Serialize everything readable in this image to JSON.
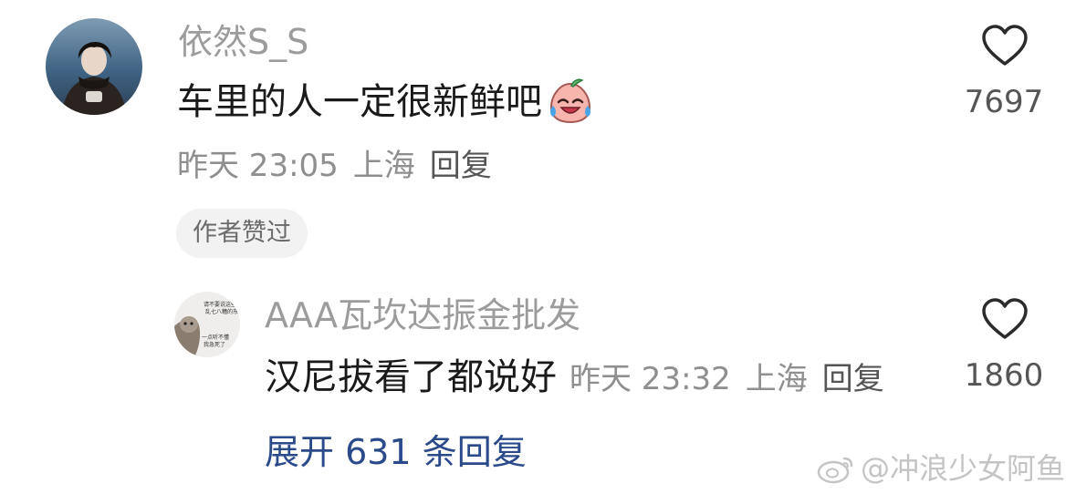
{
  "comment": {
    "username": "依然S_S",
    "text": "车里的人一定很新鲜吧",
    "emoji": "crying-laughing-peach-emoji",
    "time": "昨天 23:05",
    "location": "上海",
    "reply_label": "回复",
    "author_liked": "作者赞过",
    "like_count": "7697"
  },
  "reply": {
    "username": "AAA瓦坎达振金批发",
    "text": "汉尼拔看了都说好",
    "time": "昨天 23:32",
    "location": "上海",
    "reply_label": "回复",
    "like_count": "1860",
    "avatar_caption_1": "请不要说这些",
    "avatar_caption_2": "乱七八糟的东西",
    "avatar_caption_3": "一点听不懂",
    "avatar_caption_4": "我急死了"
  },
  "expand_replies": "展开 631 条回复",
  "watermark": "@冲浪少女阿鱼",
  "colors": {
    "username": "#9c9c9c",
    "link": "#2a4a8a",
    "badge_bg": "#f2f2f2"
  }
}
